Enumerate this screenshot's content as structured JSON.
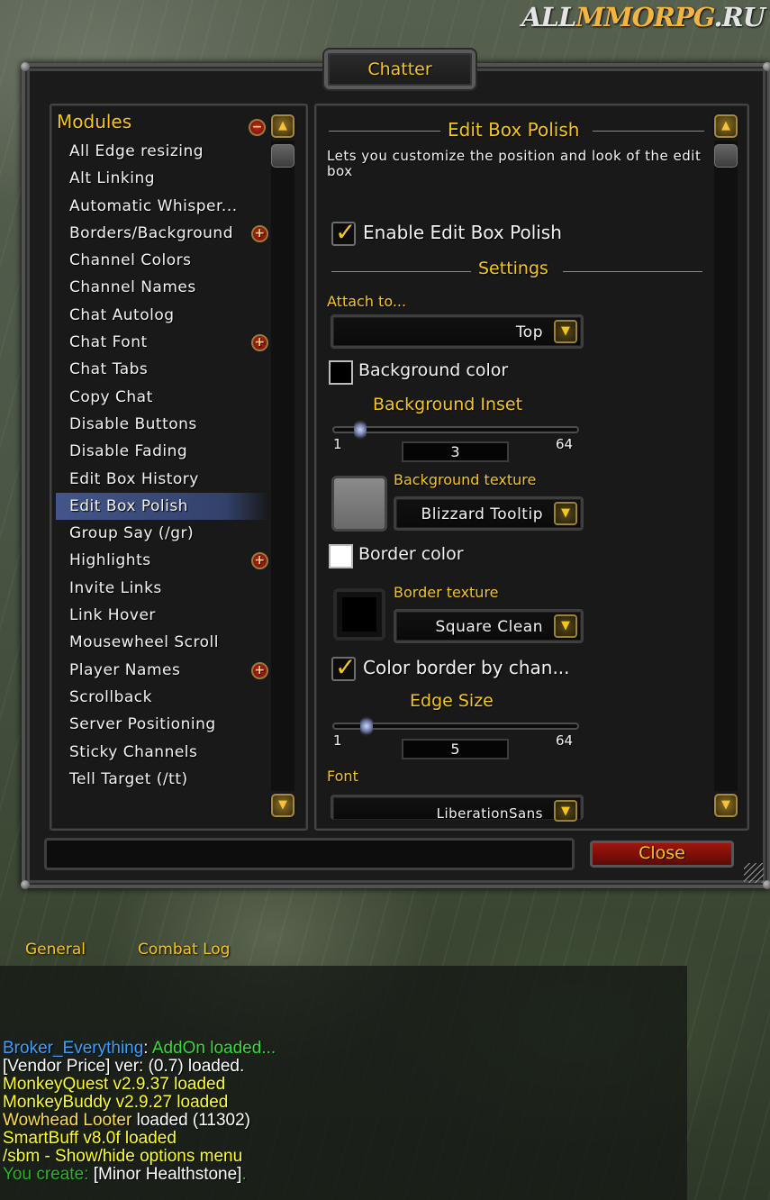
{
  "watermark": {
    "part1": "ALL",
    "part2": "MMORPG",
    "part3": ".RU"
  },
  "window": {
    "title": "Chatter",
    "close_label": "Close"
  },
  "modules": {
    "header": "Modules",
    "items": [
      {
        "label": "All Edge resizing",
        "expandable": false
      },
      {
        "label": "Alt Linking",
        "expandable": false
      },
      {
        "label": "Automatic Whisper...",
        "expandable": false
      },
      {
        "label": "Borders/Background",
        "expandable": true
      },
      {
        "label": "Channel Colors",
        "expandable": false
      },
      {
        "label": "Channel Names",
        "expandable": false
      },
      {
        "label": "Chat Autolog",
        "expandable": false
      },
      {
        "label": "Chat Font",
        "expandable": true
      },
      {
        "label": "Chat Tabs",
        "expandable": false
      },
      {
        "label": "Copy Chat",
        "expandable": false
      },
      {
        "label": "Disable Buttons",
        "expandable": false
      },
      {
        "label": "Disable Fading",
        "expandable": false
      },
      {
        "label": "Edit Box History",
        "expandable": false
      },
      {
        "label": "Edit Box Polish",
        "expandable": false,
        "selected": true
      },
      {
        "label": "Group Say (/gr)",
        "expandable": false
      },
      {
        "label": "Highlights",
        "expandable": true
      },
      {
        "label": "Invite Links",
        "expandable": false
      },
      {
        "label": "Link Hover",
        "expandable": false
      },
      {
        "label": "Mousewheel Scroll",
        "expandable": false
      },
      {
        "label": "Player Names",
        "expandable": true
      },
      {
        "label": "Scrollback",
        "expandable": false
      },
      {
        "label": "Server Positioning",
        "expandable": false
      },
      {
        "label": "Sticky Channels",
        "expandable": false
      },
      {
        "label": "Tell Target (/tt)",
        "expandable": false
      }
    ]
  },
  "detail": {
    "title": "Edit Box Polish",
    "description": "Lets you customize the position and look of the edit box",
    "enable_label": "Enable Edit Box Polish",
    "enable_checked": true,
    "settings_header": "Settings",
    "attach_label": "Attach to...",
    "attach_value": "Top",
    "bg_color_label": "Background color",
    "bg_color": "#000000",
    "bg_inset_label": "Background Inset",
    "bg_inset": {
      "min": "1",
      "max": "64",
      "value": "3"
    },
    "bg_texture_label": "Background texture",
    "bg_texture_value": "Blizzard Tooltip",
    "border_color_label": "Border color",
    "border_color": "#ffffff",
    "border_texture_label": "Border texture",
    "border_texture_value": "Square Clean",
    "color_by_channel_label": "Color border by chan...",
    "color_by_channel_checked": true,
    "edge_size_label": "Edge Size",
    "edge_size": {
      "min": "1",
      "max": "64",
      "value": "5"
    },
    "font_label": "Font",
    "font_value": "LiberationSans"
  },
  "chat": {
    "tabs": [
      "General",
      "Combat Log"
    ],
    "lines": [
      {
        "segments": [
          {
            "text": "Broker_Everything",
            "color": "#3aa0ff"
          },
          {
            "text": ": ",
            "color": "#ffffff"
          },
          {
            "text": "AddOn loaded...",
            "color": "#33dd33"
          }
        ]
      },
      {
        "segments": [
          {
            "text": "[Vendor Price] ver: (0.7) loaded.",
            "color": "#ffffff"
          }
        ]
      },
      {
        "segments": [
          {
            "text": "MonkeyQuest v2.9.37 loaded",
            "color": "#ffff22"
          }
        ]
      },
      {
        "segments": [
          {
            "text": "MonkeyBuddy v2.9.27 loaded",
            "color": "#ffff22"
          }
        ]
      },
      {
        "segments": [
          {
            "text": "Wowhead Looter",
            "color": "#ffdd44"
          },
          {
            "text": " loaded (11302)",
            "color": "#ffffff"
          }
        ]
      },
      {
        "segments": [
          {
            "text": "SmartBuff v8.0f loaded",
            "color": "#ffff22"
          }
        ]
      },
      {
        "segments": [
          {
            "text": "/sbm - Show/hide options menu",
            "color": "#ffff22"
          }
        ]
      },
      {
        "segments": [
          {
            "text": "You create: ",
            "color": "#22bb22"
          },
          {
            "text": "[Minor Healthstone]",
            "color": "#ffffff"
          },
          {
            "text": ".",
            "color": "#22bb22"
          }
        ]
      }
    ]
  },
  "icons": {
    "scroll_up": "arrow-up-icon",
    "scroll_down": "arrow-down-icon",
    "expand": "plus-icon",
    "collapse": "minus-icon",
    "dropdown": "chevron-down-icon",
    "check": "checkmark-icon"
  },
  "colors": {
    "accent_gold": "#f5c518",
    "selected_row": "#43558a",
    "close_button": "#a0150e"
  }
}
